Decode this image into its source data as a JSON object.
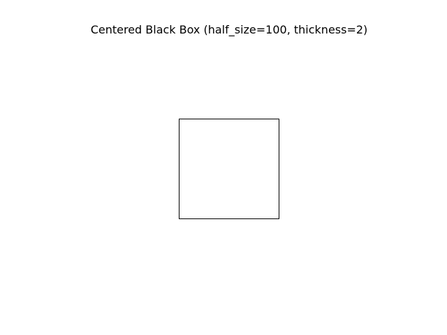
{
  "figure": {
    "title": "Centered Black Box (half_size=100, thickness=2)",
    "background_color": "#ffffff",
    "box_color": "#000000"
  }
}
